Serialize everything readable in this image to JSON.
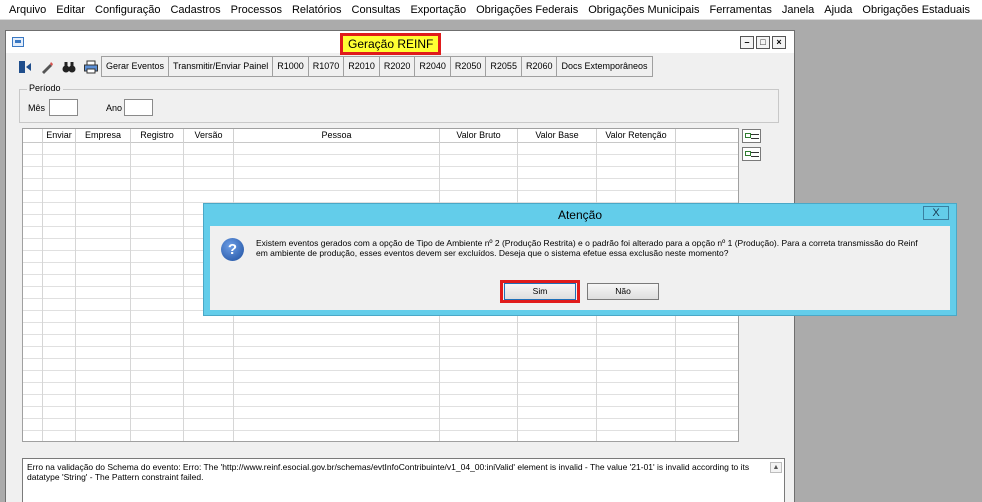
{
  "menu": [
    "Arquivo",
    "Editar",
    "Configuração",
    "Cadastros",
    "Processos",
    "Relatórios",
    "Consultas",
    "Exportação",
    "Obrigações Federais",
    "Obrigações Municipais",
    "Ferramentas",
    "Janela",
    "Ajuda",
    "Obrigações Estaduais"
  ],
  "window": {
    "title": "Geração REINF",
    "controls": [
      "minimize-icon",
      "restore-icon",
      "close-icon"
    ]
  },
  "toolbar": {
    "icons": [
      "exit-icon",
      "pencil-icon",
      "binoculars-icon",
      "printer-icon"
    ],
    "buttons": [
      "Gerar Eventos",
      "Transmitir/Enviar Painel",
      "R1000",
      "R1070",
      "R2010",
      "R2020",
      "R2040",
      "R2050",
      "R2055",
      "R2060",
      "Docs Extemporâneos"
    ]
  },
  "periodo": {
    "legend": "Período",
    "mes_label": "Mês",
    "mes_value": "",
    "ano_label": "Ano",
    "ano_value": ""
  },
  "grid": {
    "columns": [
      "Enviar",
      "Empresa",
      "Registro",
      "Versão",
      "Pessoa",
      "Valor Bruto",
      "Valor Base",
      "Valor Retenção"
    ],
    "rows": []
  },
  "side_icons": [
    "checklist-icon",
    "list-icon"
  ],
  "error": {
    "text": "Erro na validação do Schema do evento: Erro: The 'http://www.reinf.esocial.gov.br/schemas/evtInfoContribuinte/v1_04_00:iniValid' element is invalid - The value '21-01' is invalid according to its datatype 'String' - The Pattern constraint failed."
  },
  "dialog": {
    "title": "Atenção",
    "icon": "question-icon",
    "message": "Existem eventos gerados com a opção de Tipo de Ambiente nº 2 (Produção Restrita) e o padrão foi alterado para a opção nº 1 (Produção). Para a correta transmissão do Reinf em ambiente de produção, esses eventos devem ser excluídos. Deseja que o sistema efetue essa exclusão neste momento?",
    "yes_label": "Sim",
    "no_label": "Não",
    "close_glyph": "X"
  },
  "colors": {
    "highlight_yellow": "#ffff33",
    "annotation_red": "#e01b1b",
    "dialog_blue": "#63cdea"
  }
}
